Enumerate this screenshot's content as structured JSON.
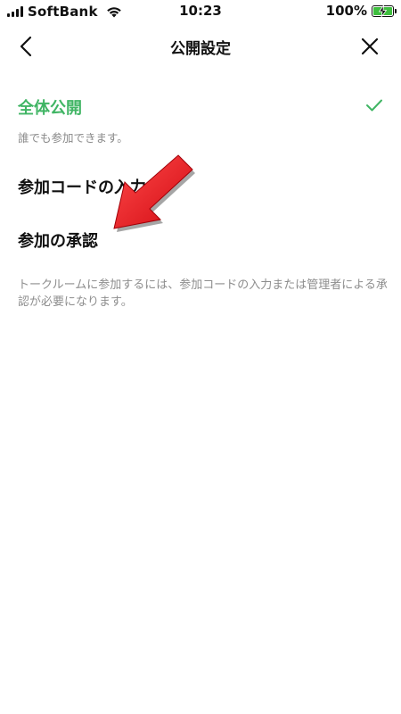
{
  "status_bar": {
    "carrier": "SoftBank",
    "time": "10:23",
    "battery_percent": "100%",
    "battery_level": 1.0
  },
  "nav": {
    "title": "公開設定",
    "back_icon": "chevron-left-icon",
    "close_icon": "close-icon"
  },
  "options": {
    "public": {
      "title": "全体公開",
      "description": "誰でも参加できます。",
      "selected": true,
      "color": "#40b564"
    },
    "code": {
      "title": "参加コードの入力"
    },
    "approval": {
      "title": "参加の承認"
    }
  },
  "footnote": "トークルームに参加するには、参加コードの入力または管理者による承認が必要になります。",
  "annotation": {
    "arrow_color": "#e8141b"
  }
}
